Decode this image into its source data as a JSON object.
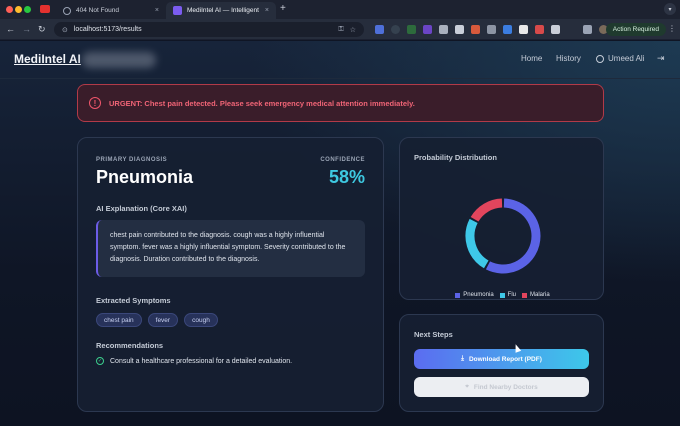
{
  "browser": {
    "tabs": [
      {
        "title": "404 Not Found",
        "active": false
      },
      {
        "title": "MediIntel AI — Intelligent Me",
        "active": true
      }
    ],
    "url": "localhost:5173/results",
    "action_required": "Action Required",
    "new_tab_symbol": "+",
    "close_symbol": "×"
  },
  "app": {
    "brand": "MediIntel AI",
    "nav": {
      "home": "Home",
      "history": "History",
      "user": "Umeed Ali"
    }
  },
  "alert": {
    "icon": "!",
    "text": "URGENT: Chest pain detected. Please seek emergency medical attention immediately."
  },
  "diagnosis": {
    "primary_label": "PRIMARY DIAGNOSIS",
    "primary_value": "Pneumonia",
    "confidence_label": "CONFIDENCE",
    "confidence_value": "58%",
    "xai_title": "AI Explanation (Core XAI)",
    "xai_text": "chest pain contributed to the diagnosis. cough was a highly influential symptom. fever was a highly influential symptom. Severity contributed to the diagnosis. Duration contributed to the diagnosis.",
    "symptoms_title": "Extracted Symptoms",
    "symptoms": [
      "chest pain",
      "fever",
      "cough"
    ],
    "recommendations_title": "Recommendations",
    "recommendations": [
      "Consult a healthcare professional for a detailed evaluation."
    ]
  },
  "probability": {
    "title": "Probability Distribution"
  },
  "chart_data": {
    "type": "pie",
    "categories": [
      "Pneumonia",
      "Flu",
      "Malaria"
    ],
    "values": [
      58,
      25,
      17
    ],
    "colors": [
      "#5b63e6",
      "#3ec8e8",
      "#e2455d"
    ],
    "legend_position": "bottom"
  },
  "next_steps": {
    "title": "Next Steps",
    "download": "Download Report (PDF)",
    "doctors": "Find Nearby Doctors"
  }
}
